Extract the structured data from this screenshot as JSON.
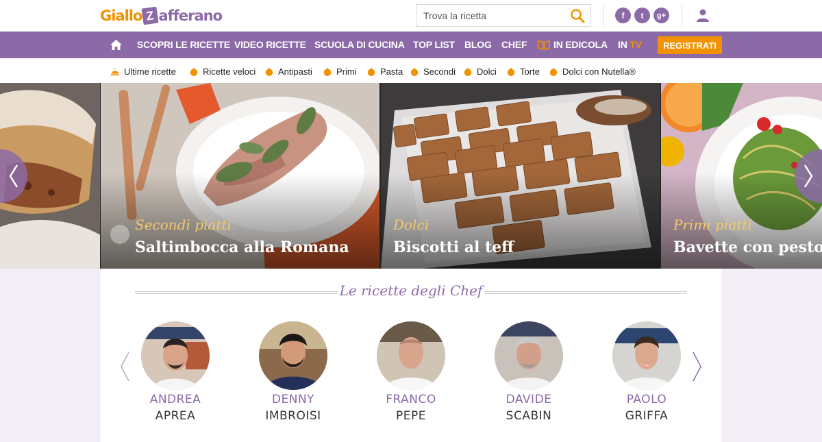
{
  "logo": {
    "part1": "Giallo",
    "z": "Z",
    "part2": "afferano"
  },
  "search": {
    "placeholder": "Trova la ricetta"
  },
  "social": {
    "facebook": "f",
    "twitter": "t",
    "googleplus": "g+"
  },
  "nav": {
    "items": [
      "Scopri le ricette",
      "Video ricette",
      "Scuola di cucina",
      "Top list",
      "Blog",
      "Chef",
      "In edicola"
    ],
    "in_label": "In",
    "tv_label": "TV",
    "register": "Registrati"
  },
  "categories": [
    "Ultime ricette",
    "Ricette veloci",
    "Antipasti",
    "Primi",
    "Pasta",
    "Secondi",
    "Dolci",
    "Torte",
    "Dolci con Nutella®"
  ],
  "carousel": {
    "slides": [
      {
        "category": "",
        "title": ""
      },
      {
        "category": "Secondi piatti",
        "title": "Saltimbocca alla Romana"
      },
      {
        "category": "Dolci",
        "title": "Biscotti al teff"
      },
      {
        "category": "Primi piatti",
        "title": "Bavette con pesto di"
      }
    ]
  },
  "chef_section": {
    "title": "Le ricette degli Chef",
    "chefs": [
      {
        "first": "Andrea",
        "last": "Aprea"
      },
      {
        "first": "Denny",
        "last": "Imbroisi"
      },
      {
        "first": "Franco",
        "last": "Pepe"
      },
      {
        "first": "Davide",
        "last": "Scabin"
      },
      {
        "first": "Paolo",
        "last": "Griffa"
      }
    ]
  },
  "colors": {
    "purple": "#8c6aa8",
    "orange": "#f39200",
    "lavender_bg": "#f3eef5"
  }
}
